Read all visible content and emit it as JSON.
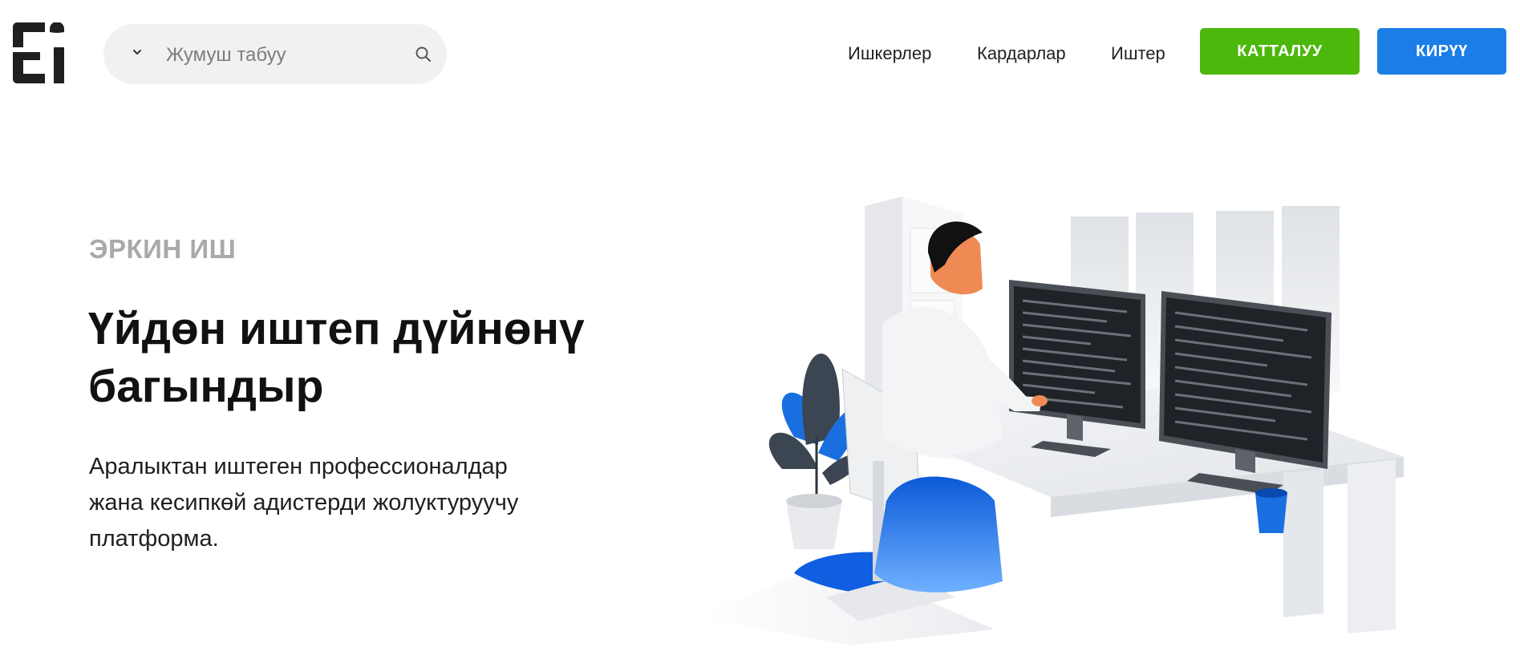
{
  "header": {
    "logo_alt": "Эркин Иш логотиби",
    "search": {
      "placeholder": "Жумуш табуу",
      "value": ""
    },
    "nav": [
      {
        "label": "Ишкерлер"
      },
      {
        "label": "Кардарлар"
      },
      {
        "label": "Иштер"
      }
    ],
    "register_label": "КАТТАЛУУ",
    "login_label": "КИРҮҮ"
  },
  "hero": {
    "eyebrow": "ЭРКИН ИШ",
    "headline_line1": "Үйдөн иштеп дүйнөнү",
    "headline_line2": "багындыр",
    "subtitle_line1": "Аралыктан иштеген профессионалдар",
    "subtitle_line2": "жана кесипкөй адистерди жолуктуруучу",
    "subtitle_line3": "платформа."
  },
  "colors": {
    "register": "#4cb80c",
    "login": "#1a7ee6",
    "accent_blue": "#0f5fe0",
    "eyebrow_gray": "#a9a9a9"
  },
  "icons": {
    "logo": "ei-logo-icon",
    "chevron": "chevron-down-icon",
    "search": "search-icon"
  }
}
